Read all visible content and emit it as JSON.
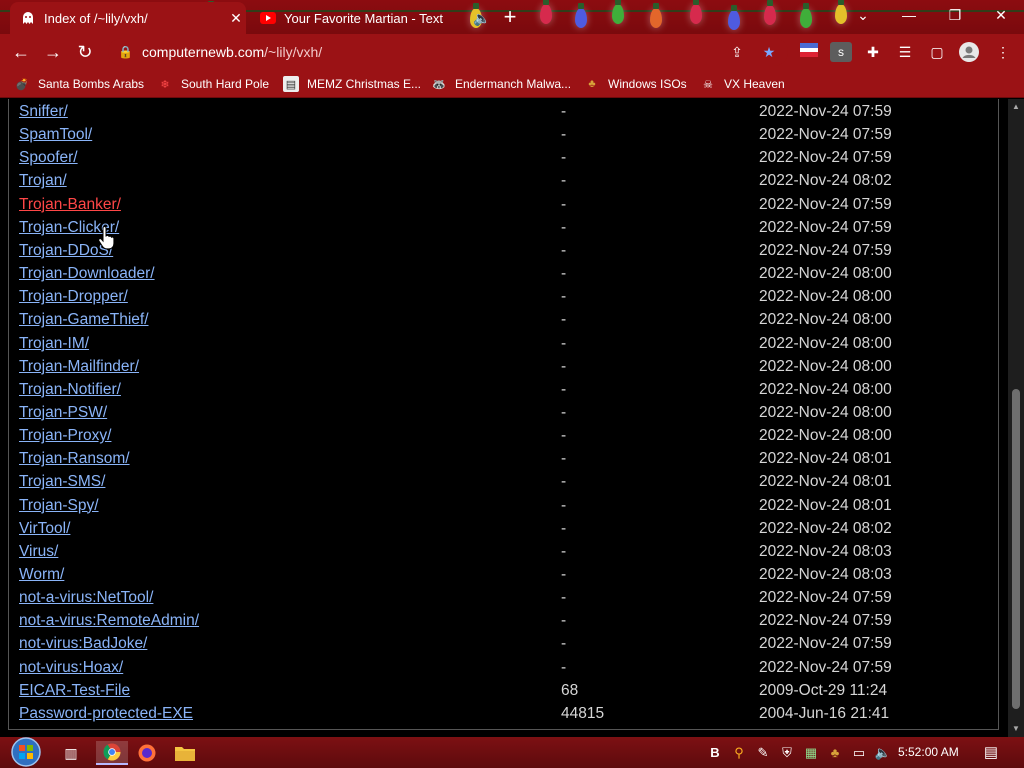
{
  "browser": {
    "tabs": [
      {
        "title": "Index of /~lily/vxh/",
        "active": true,
        "favicon": "ghost-icon"
      },
      {
        "title": "Your Favorite Martian - Text",
        "active": false,
        "favicon": "youtube-icon",
        "audio": "speaker-icon"
      }
    ],
    "address": {
      "host": "computernewb.com",
      "path": "/~lily/vxh/"
    },
    "bookmarks": [
      {
        "label": "Santa Bombs Arabs",
        "icon": "bomb-icon"
      },
      {
        "label": "South Hard Pole",
        "icon": "snowflake-icon"
      },
      {
        "label": "MEMZ Christmas E...",
        "icon": "document-icon"
      },
      {
        "label": "Endermanch Malwa...",
        "icon": "raccoon-icon"
      },
      {
        "label": "Windows ISOs",
        "icon": "tree-icon"
      },
      {
        "label": "VX Heaven",
        "icon": "skull-icon"
      }
    ],
    "theme": {
      "frame": "#9b1215",
      "link": "#8ab4f8",
      "link_hover": "#ff4747"
    }
  },
  "listing": {
    "rows": [
      {
        "name": "Sniffer/",
        "size": "-",
        "date": "2022-Nov-24 07:59"
      },
      {
        "name": "SpamTool/",
        "size": "-",
        "date": "2022-Nov-24 07:59"
      },
      {
        "name": "Spoofer/",
        "size": "-",
        "date": "2022-Nov-24 07:59"
      },
      {
        "name": "Trojan/",
        "size": "-",
        "date": "2022-Nov-24 08:02"
      },
      {
        "name": "Trojan-Banker/",
        "size": "-",
        "date": "2022-Nov-24 07:59",
        "hover": true
      },
      {
        "name": "Trojan-Clicker/",
        "size": "-",
        "date": "2022-Nov-24 07:59"
      },
      {
        "name": "Trojan-DDoS/",
        "size": "-",
        "date": "2022-Nov-24 07:59"
      },
      {
        "name": "Trojan-Downloader/",
        "size": "-",
        "date": "2022-Nov-24 08:00"
      },
      {
        "name": "Trojan-Dropper/",
        "size": "-",
        "date": "2022-Nov-24 08:00"
      },
      {
        "name": "Trojan-GameThief/",
        "size": "-",
        "date": "2022-Nov-24 08:00"
      },
      {
        "name": "Trojan-IM/",
        "size": "-",
        "date": "2022-Nov-24 08:00"
      },
      {
        "name": "Trojan-Mailfinder/",
        "size": "-",
        "date": "2022-Nov-24 08:00"
      },
      {
        "name": "Trojan-Notifier/",
        "size": "-",
        "date": "2022-Nov-24 08:00"
      },
      {
        "name": "Trojan-PSW/",
        "size": "-",
        "date": "2022-Nov-24 08:00"
      },
      {
        "name": "Trojan-Proxy/",
        "size": "-",
        "date": "2022-Nov-24 08:00"
      },
      {
        "name": "Trojan-Ransom/",
        "size": "-",
        "date": "2022-Nov-24 08:01"
      },
      {
        "name": "Trojan-SMS/",
        "size": "-",
        "date": "2022-Nov-24 08:01"
      },
      {
        "name": "Trojan-Spy/",
        "size": "-",
        "date": "2022-Nov-24 08:01"
      },
      {
        "name": "VirTool/",
        "size": "-",
        "date": "2022-Nov-24 08:02"
      },
      {
        "name": "Virus/",
        "size": "-",
        "date": "2022-Nov-24 08:03"
      },
      {
        "name": "Worm/",
        "size": "-",
        "date": "2022-Nov-24 08:03"
      },
      {
        "name": "not-a-virus:NetTool/",
        "size": "-",
        "date": "2022-Nov-24 07:59"
      },
      {
        "name": "not-a-virus:RemoteAdmin/",
        "size": "-",
        "date": "2022-Nov-24 07:59"
      },
      {
        "name": "not-virus:BadJoke/",
        "size": "-",
        "date": "2022-Nov-24 07:59"
      },
      {
        "name": "not-virus:Hoax/",
        "size": "-",
        "date": "2022-Nov-24 07:59"
      },
      {
        "name": "EICAR-Test-File",
        "size": "68",
        "date": "2009-Oct-29 11:24"
      },
      {
        "name": "Password-protected-EXE",
        "size": "44815",
        "date": "2004-Jun-16 21:41"
      }
    ]
  },
  "taskbar": {
    "clock": "5:52:00 AM",
    "apps": [
      "start-orb-icon",
      "task-view-icon",
      "chrome-icon",
      "firefox-icon",
      "file-explorer-icon"
    ]
  }
}
